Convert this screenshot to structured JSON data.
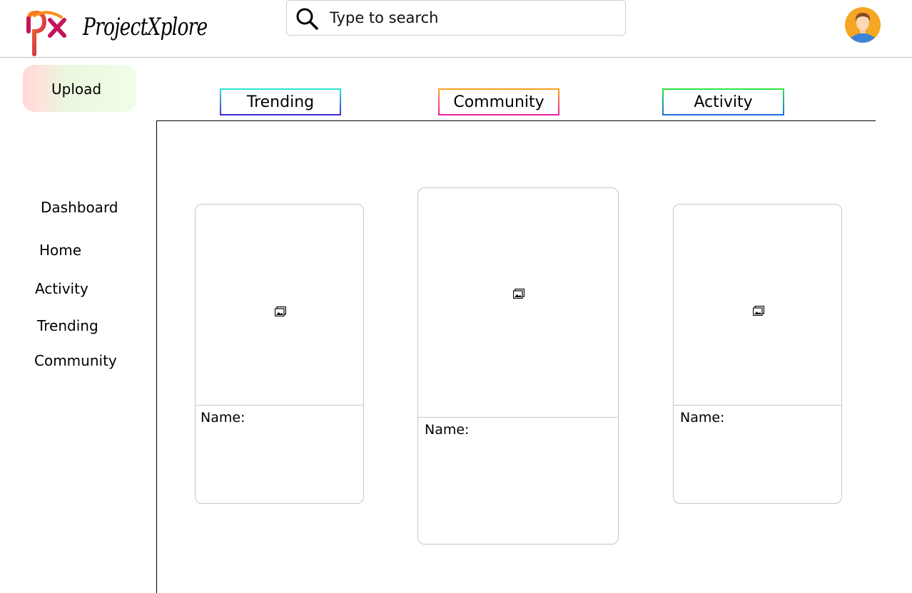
{
  "header": {
    "brand": "ProjectXplore",
    "logo_text": "px",
    "search_placeholder": "Type to search"
  },
  "upload_label": "Upload",
  "tabs": [
    {
      "label": "Trending"
    },
    {
      "label": "Community"
    },
    {
      "label": "Activity"
    }
  ],
  "sidebar": {
    "items": [
      {
        "label": "Dashboard"
      },
      {
        "label": "Home"
      },
      {
        "label": "Activity"
      },
      {
        "label": "Trending"
      },
      {
        "label": "Community"
      }
    ]
  },
  "cards": [
    {
      "name_label": "Name:",
      "image_icon": "image-placeholder-icon"
    },
    {
      "name_label": "Name:",
      "image_icon": "image-placeholder-icon"
    },
    {
      "name_label": "Name:",
      "image_icon": "image-placeholder-icon"
    }
  ],
  "colors": {
    "tab_trending": [
      "#2ee6d6",
      "#3b2bd9"
    ],
    "tab_community": [
      "#ffa21a",
      "#ee1ea0"
    ],
    "tab_activity": [
      "#2ee63a",
      "#1e6ee8"
    ],
    "avatar_bg": "#f5a623"
  }
}
